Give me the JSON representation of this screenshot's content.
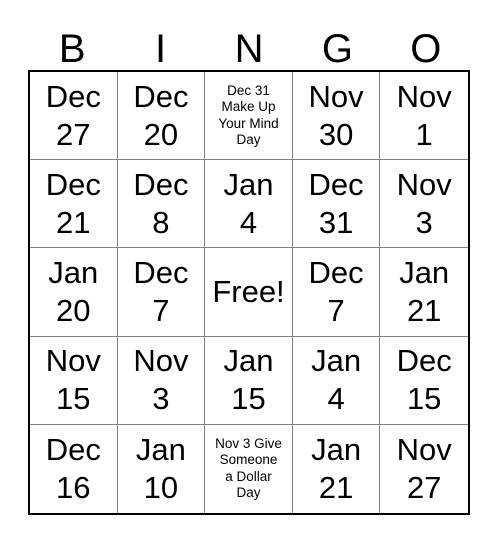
{
  "card": {
    "header": {
      "letters": [
        "B",
        "I",
        "N",
        "G",
        "O"
      ]
    },
    "colors": {
      "outer_border": "#000000",
      "inner_gridline": "#808080",
      "text": "#000000",
      "background": "#ffffff"
    },
    "rows": [
      [
        {
          "text": "Dec\n27",
          "size": "big"
        },
        {
          "text": "Dec\n20",
          "size": "big"
        },
        {
          "text": "Dec 31\nMake Up\nYour Mind\nDay",
          "size": "small"
        },
        {
          "text": "Nov\n30",
          "size": "big"
        },
        {
          "text": "Nov\n1",
          "size": "big"
        }
      ],
      [
        {
          "text": "Dec\n21",
          "size": "big"
        },
        {
          "text": "Dec\n8",
          "size": "big"
        },
        {
          "text": "Jan\n4",
          "size": "big"
        },
        {
          "text": "Dec\n31",
          "size": "big"
        },
        {
          "text": "Nov\n3",
          "size": "big"
        }
      ],
      [
        {
          "text": "Jan\n20",
          "size": "big"
        },
        {
          "text": "Dec\n7",
          "size": "big"
        },
        {
          "text": "Free!",
          "size": "free"
        },
        {
          "text": "Dec\n7",
          "size": "big"
        },
        {
          "text": "Jan\n21",
          "size": "big"
        }
      ],
      [
        {
          "text": "Nov\n15",
          "size": "big"
        },
        {
          "text": "Nov\n3",
          "size": "big"
        },
        {
          "text": "Jan\n15",
          "size": "big"
        },
        {
          "text": "Jan\n4",
          "size": "big"
        },
        {
          "text": "Dec\n15",
          "size": "big"
        }
      ],
      [
        {
          "text": "Dec\n16",
          "size": "big"
        },
        {
          "text": "Jan\n10",
          "size": "big"
        },
        {
          "text": "Nov 3 Give\nSomeone\na Dollar\nDay",
          "size": "small"
        },
        {
          "text": "Jan\n21",
          "size": "big"
        },
        {
          "text": "Nov\n27",
          "size": "big"
        }
      ]
    ]
  }
}
